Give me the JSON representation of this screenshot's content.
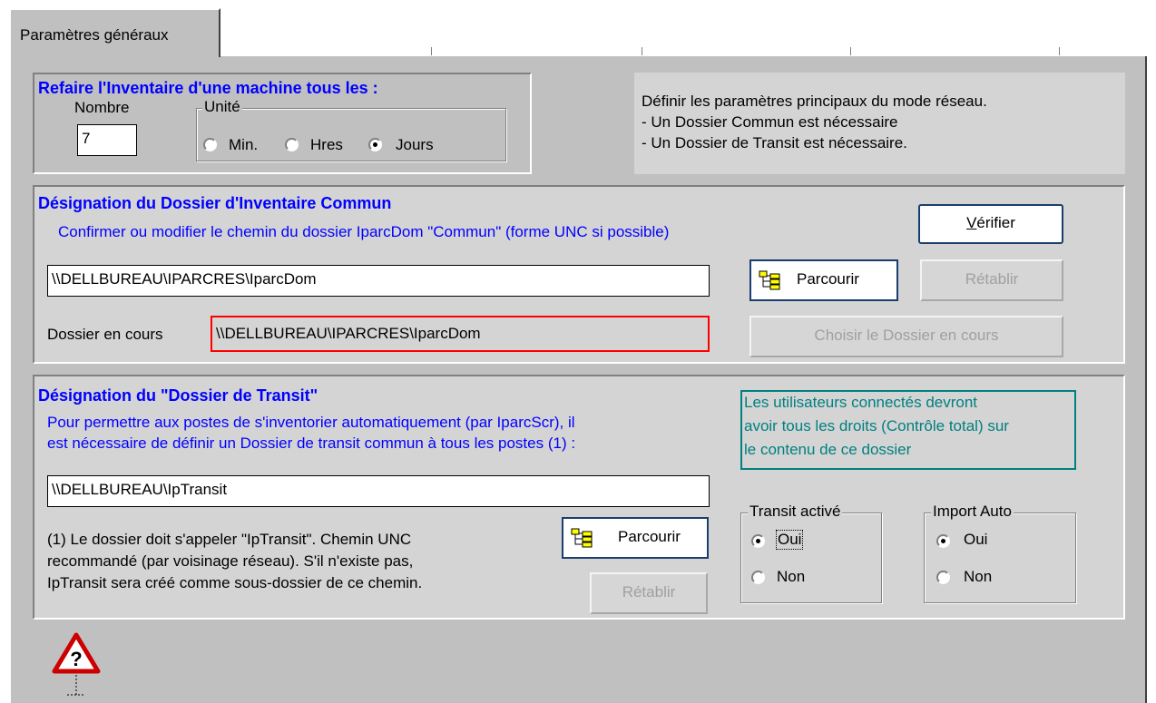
{
  "tabs": {
    "active": "Paramètres généraux"
  },
  "inventory_interval": {
    "title": "Refaire l'Inventaire d'une machine tous les :",
    "number_label": "Nombre",
    "number_value": "7",
    "unit_group_label": "Unité",
    "units": [
      {
        "label": "Min.",
        "selected": false
      },
      {
        "label": "Hres",
        "selected": false
      },
      {
        "label": "Jours",
        "selected": true
      }
    ]
  },
  "info_box": {
    "lines": [
      "Définir les paramètres principaux du mode réseau.",
      "- Un Dossier Commun est nécessaire",
      "- Un Dossier de Transit est nécessaire."
    ]
  },
  "common_folder": {
    "title": "Désignation du Dossier d'Inventaire Commun",
    "description": "Confirmer ou modifier le chemin du dossier IparcDom \"Commun\" (forme UNC si possible)",
    "verify_button": "Vérifier",
    "path_value": "\\\\DELLBUREAU\\IPARCRES\\IparcDom",
    "browse_button": "Parcourir",
    "restore_button": "Rétablir",
    "current_label": "Dossier en cours",
    "current_value": "\\\\DELLBUREAU\\IPARCRES\\IparcDom",
    "choose_current_button": "Choisir le Dossier en cours"
  },
  "transit_folder": {
    "title": "Désignation du \"Dossier de Transit\"",
    "description_lines": [
      "Pour permettre aux postes de s'inventorier automatiquement (par IparcScr), il",
      "est nécessaire de définir un Dossier de transit commun à tous les postes (1) :"
    ],
    "warning_lines": [
      "Les utilisateurs connectés devront",
      "avoir tous les droits (Contrôle total) sur",
      "le contenu de ce dossier"
    ],
    "path_value": "\\\\DELLBUREAU\\IpTransit",
    "note_lines": [
      "(1) Le dossier doit s'appeler \"IpTransit\". Chemin UNC",
      "recommandé (par voisinage réseau). S'il n'existe pas,",
      "IpTransit sera créé comme sous-dossier de ce chemin."
    ],
    "browse_button": "Parcourir",
    "restore_button": "Rétablir",
    "transit_active": {
      "label": "Transit activé",
      "options": [
        {
          "label": "Oui",
          "selected": true
        },
        {
          "label": "Non",
          "selected": false
        }
      ]
    },
    "import_auto": {
      "label": "Import Auto",
      "options": [
        {
          "label": "Oui",
          "selected": true
        },
        {
          "label": "Non",
          "selected": false
        }
      ]
    }
  },
  "help_icon": "warning-question-icon",
  "colors": {
    "title_blue": "#0000ff",
    "warning_green": "#008080",
    "current_border_red": "#ff0000"
  }
}
